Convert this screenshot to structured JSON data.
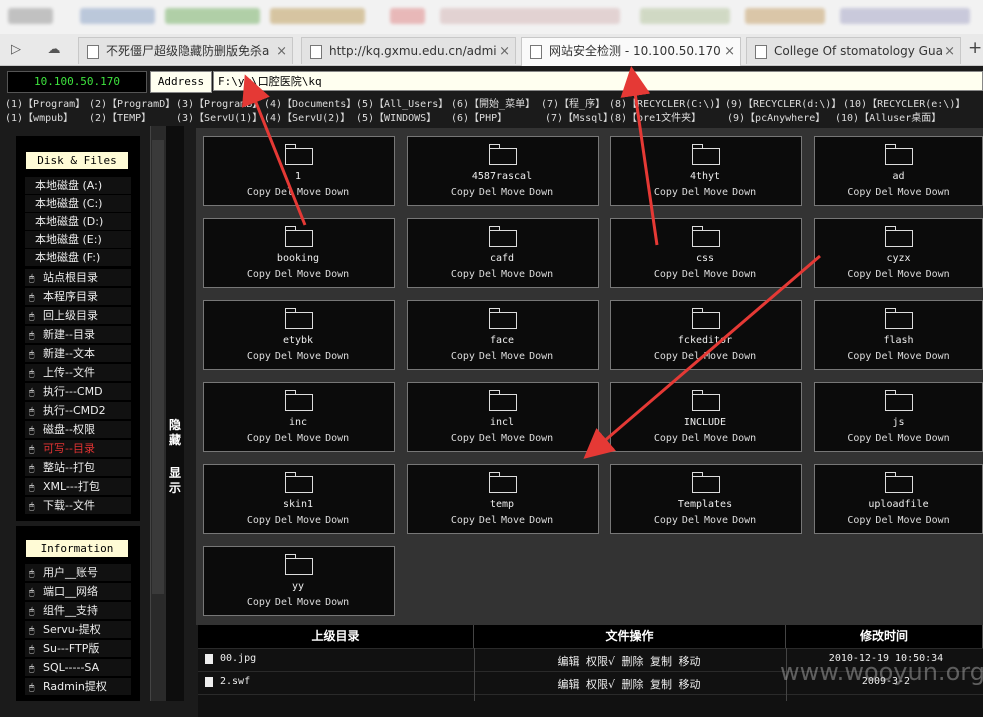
{
  "browser": {
    "tabs": [
      {
        "title": "不死僵尸超级隐藏防删版免杀a",
        "active": false
      },
      {
        "title": "http://kq.gxmu.edu.cn/admi",
        "active": false
      },
      {
        "title": "网站安全检测 - 10.100.50.170",
        "active": true
      },
      {
        "title": "College Of stomatology Gua",
        "active": false
      }
    ],
    "new_tab": "+",
    "close_glyph": "×"
  },
  "header": {
    "ip": "10.100.50.170",
    "address_label": "Address",
    "address_value": "F:\\yy\\口腔医院\\kq"
  },
  "shortcuts_row1": [
    "(1)【Program】",
    "(2)【ProgramD】",
    "(3)【ProgramB】",
    "(4)【Documents】",
    "(5)【All_Users】",
    "(6)【開始_菜单】",
    "(7)【程_序】",
    "(8)【RECYCLER(C:\\)】",
    "(9)【RECYCLER(d:\\)】",
    "(10)【RECYCLER(e:\\)】"
  ],
  "shortcuts_row2": [
    "(1)【wmpub】",
    "(2)【TEMP】",
    "(3)【ServU(1)】",
    "(4)【ServU(2)】",
    "(5)【WINDOWS】",
    "(6)【PHP】",
    "(7)【Mssql】",
    "(8)【pre1文件夹】",
    "(9)【pcAnywhere】",
    "(10)【Alluser桌面】"
  ],
  "sidebar": {
    "disk_header": "Disk & Files",
    "drives": [
      "本地磁盘 (A:)",
      "本地磁盘 (C:)",
      "本地磁盘 (D:)",
      "本地磁盘 (E:)",
      "本地磁盘 (F:)"
    ],
    "items": [
      "站点根目录",
      "本程序目录",
      "回上级目录",
      "新建--目录",
      "新建--文本",
      "上传--文件",
      "执行---CMD",
      "执行--CMD2",
      "磁盘--权限",
      "可写--目录",
      "整站--打包",
      "XML---打包",
      "下载--文件"
    ],
    "info_header": "Information",
    "info_items": [
      "用户__账号",
      "端口__网络",
      "组件__支持",
      "Servu-提权",
      "Su---FTP版",
      "SQL-----SA",
      "Radmin提权"
    ],
    "toggle_hide": "隐藏",
    "toggle_show": "显示"
  },
  "folder_actions": [
    "Copy",
    "Del",
    "Move",
    "Down"
  ],
  "folders": [
    "1",
    "4587rascal",
    "4thyt",
    "ad",
    "booking",
    "cafd",
    "css",
    "cyzx",
    "etybk",
    "face",
    "fckeditor",
    "flash",
    "inc",
    "incl",
    "INCLUDE",
    "js",
    "skin1",
    "temp",
    "Templates",
    "uploadfile",
    "yy"
  ],
  "file_table": {
    "headers": [
      "上级目录",
      "文件操作",
      "修改时间"
    ],
    "rows": [
      {
        "name": "00.jpg",
        "ops": "编辑 权限√ 删除 复制 移动",
        "time": "2010-12-19 10:50:34"
      },
      {
        "name": "2.swf",
        "ops": "编辑 权限√ 删除 复制 移动",
        "time": "2009-3-2"
      }
    ]
  },
  "watermark": "www.wooyun.org",
  "colors": {
    "accent_red": "#e53935",
    "ip_green": "#3ee23e",
    "label_bg": "#fffbd6"
  }
}
